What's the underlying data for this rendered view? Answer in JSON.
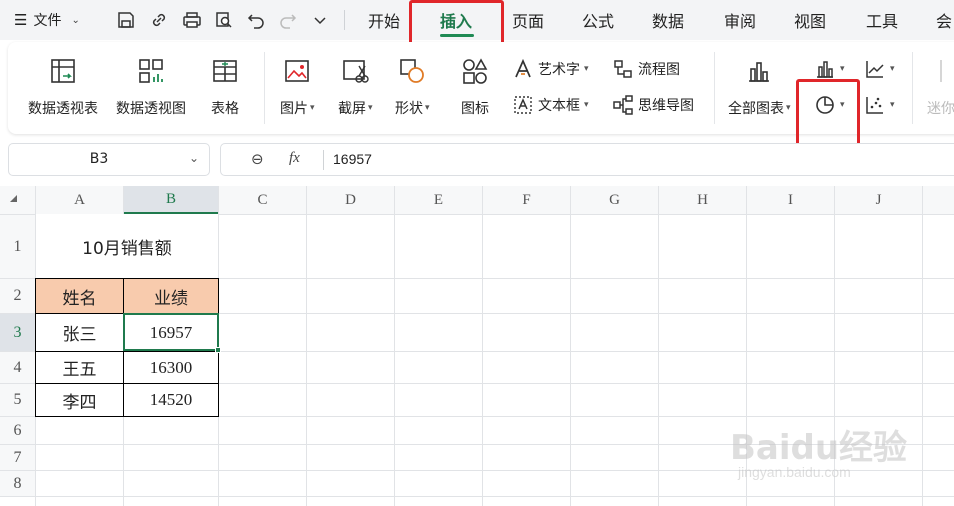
{
  "menubar": {
    "file_label": "文件",
    "tabs": [
      "开始",
      "插入",
      "页面",
      "公式",
      "数据",
      "审阅",
      "视图",
      "工具",
      "会"
    ],
    "active_tab": "插入"
  },
  "ribbon": {
    "pivot_table": "数据透视表",
    "pivot_chart": "数据透视图",
    "table": "表格",
    "picture": "图片",
    "screenshot": "截屏",
    "shape": "形状",
    "icon": "图标",
    "wordart": "艺术字",
    "flowchart": "流程图",
    "textbox": "文本框",
    "mindmap": "思维导图",
    "all_charts": "全部图表",
    "sparkline": "迷你"
  },
  "formula": {
    "name_box": "B3",
    "fx": "fx",
    "value": "16957"
  },
  "columns": [
    "A",
    "B",
    "C",
    "D",
    "E",
    "F",
    "G",
    "H",
    "I",
    "J"
  ],
  "rows": [
    "1",
    "2",
    "3",
    "4",
    "5",
    "6",
    "7",
    "8"
  ],
  "sheet": {
    "title": "10月销售额",
    "header_name": "姓名",
    "header_score": "业绩",
    "data": [
      {
        "name": "张三",
        "score": "16957"
      },
      {
        "name": "王五",
        "score": "16300"
      },
      {
        "name": "李四",
        "score": "14520"
      }
    ]
  },
  "watermark": {
    "brand": "Baidu经验",
    "url": "jingyan.baidu.com"
  },
  "colors": {
    "accent_green": "#1f7a4d",
    "header_fill": "#f8cbad",
    "highlight_red": "#e0262a"
  }
}
